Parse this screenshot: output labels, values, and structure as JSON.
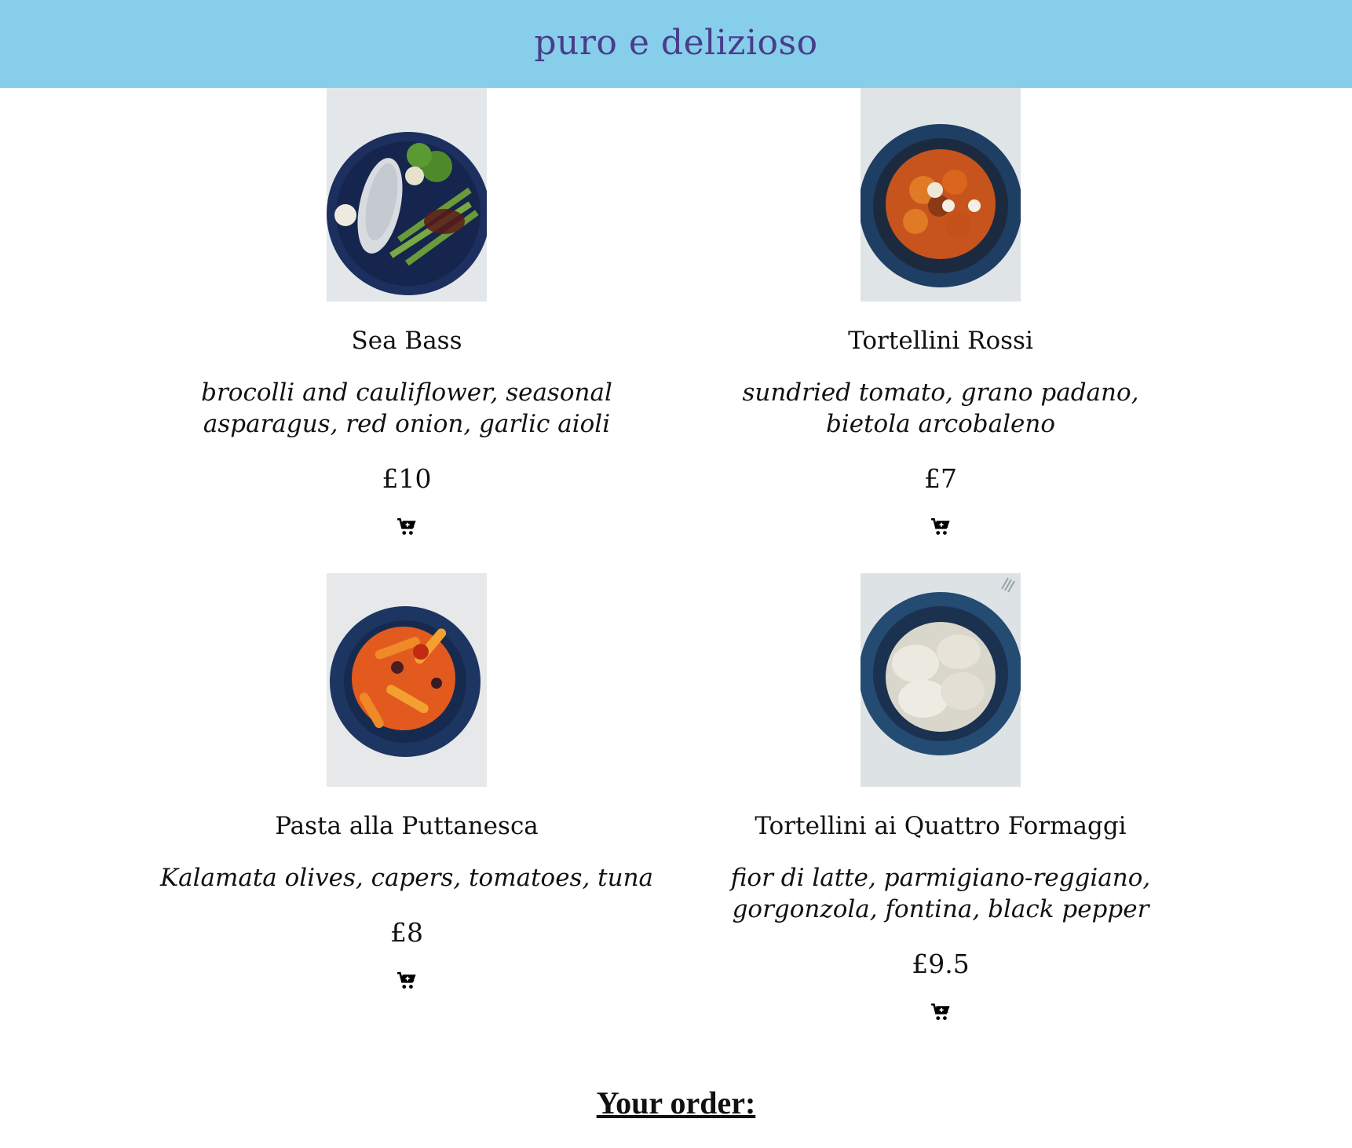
{
  "header": {
    "title": "puro e delizioso"
  },
  "menu": [
    {
      "name": "Sea Bass",
      "description": "brocolli and cauliflower, seasonal asparagus, red onion, garlic aioli",
      "price": "£10",
      "photo_icon": "sea-bass-photo",
      "cart_icon": "cart-plus-icon"
    },
    {
      "name": "Tortellini Rossi",
      "description": "sundried tomato, grano padano, bietola arcobaleno",
      "price": "£7",
      "photo_icon": "tortellini-rossi-photo",
      "cart_icon": "cart-plus-icon"
    },
    {
      "name": "Pasta alla Puttanesca",
      "description": "Kalamata olives, capers, tomatoes, tuna",
      "price": "£8",
      "photo_icon": "puttanesca-photo",
      "cart_icon": "cart-plus-icon"
    },
    {
      "name": "Tortellini ai Quattro Formaggi",
      "description": "fior di latte, parmigiano-reggiano, gorgonzola, fontina, black pepper",
      "price": "£9.5",
      "photo_icon": "quattro-formaggi-photo",
      "cart_icon": "cart-plus-icon"
    }
  ],
  "order": {
    "heading": "Your order:"
  },
  "colors": {
    "header_bg": "#87ceeb",
    "title_text": "#483d8b",
    "plate_blue": "#1c2f5e"
  }
}
